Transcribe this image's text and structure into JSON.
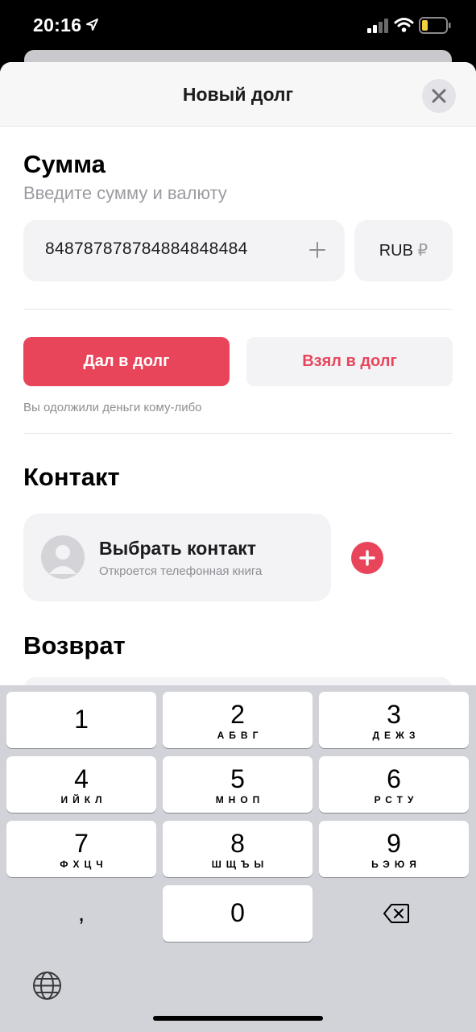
{
  "status_bar": {
    "time": "20:16"
  },
  "sheet": {
    "title": "Новый долг"
  },
  "amount_section": {
    "title": "Сумма",
    "subtitle": "Введите сумму и валюту",
    "amount_value": "84878787878488484848​4",
    "currency_code": "RUB",
    "currency_symbol": "₽"
  },
  "direction": {
    "lent_label": "Дал в долг",
    "borrowed_label": "Взял в долг",
    "hint": "Вы одолжили деньги кому-либо",
    "selected": "lent"
  },
  "contact_section": {
    "title": "Контакт",
    "select_title": "Выбрать контакт",
    "select_subtitle": "Откроется телефонная книга"
  },
  "return_section": {
    "title": "Возврат"
  },
  "keyboard": {
    "keys": [
      {
        "num": "1",
        "letters": ""
      },
      {
        "num": "2",
        "letters": "АБВГ"
      },
      {
        "num": "3",
        "letters": "ДЕЖЗ"
      },
      {
        "num": "4",
        "letters": "ИЙКЛ"
      },
      {
        "num": "5",
        "letters": "МНОП"
      },
      {
        "num": "6",
        "letters": "РСТУ"
      },
      {
        "num": "7",
        "letters": "ФХЦЧ"
      },
      {
        "num": "8",
        "letters": "ШЩЪЫ"
      },
      {
        "num": "9",
        "letters": "ЬЭЮЯ"
      },
      {
        "num": "0",
        "letters": ""
      }
    ],
    "comma": ","
  },
  "colors": {
    "accent": "#e8455b",
    "field_bg": "#f3f3f6",
    "keyboard_bg": "#d1d3d9"
  },
  "icons": [
    "location-arrow-icon",
    "signal-icon",
    "wifi-icon",
    "battery-icon",
    "close-icon",
    "plus-icon",
    "avatar-icon",
    "add-icon",
    "backspace-icon",
    "globe-icon"
  ]
}
